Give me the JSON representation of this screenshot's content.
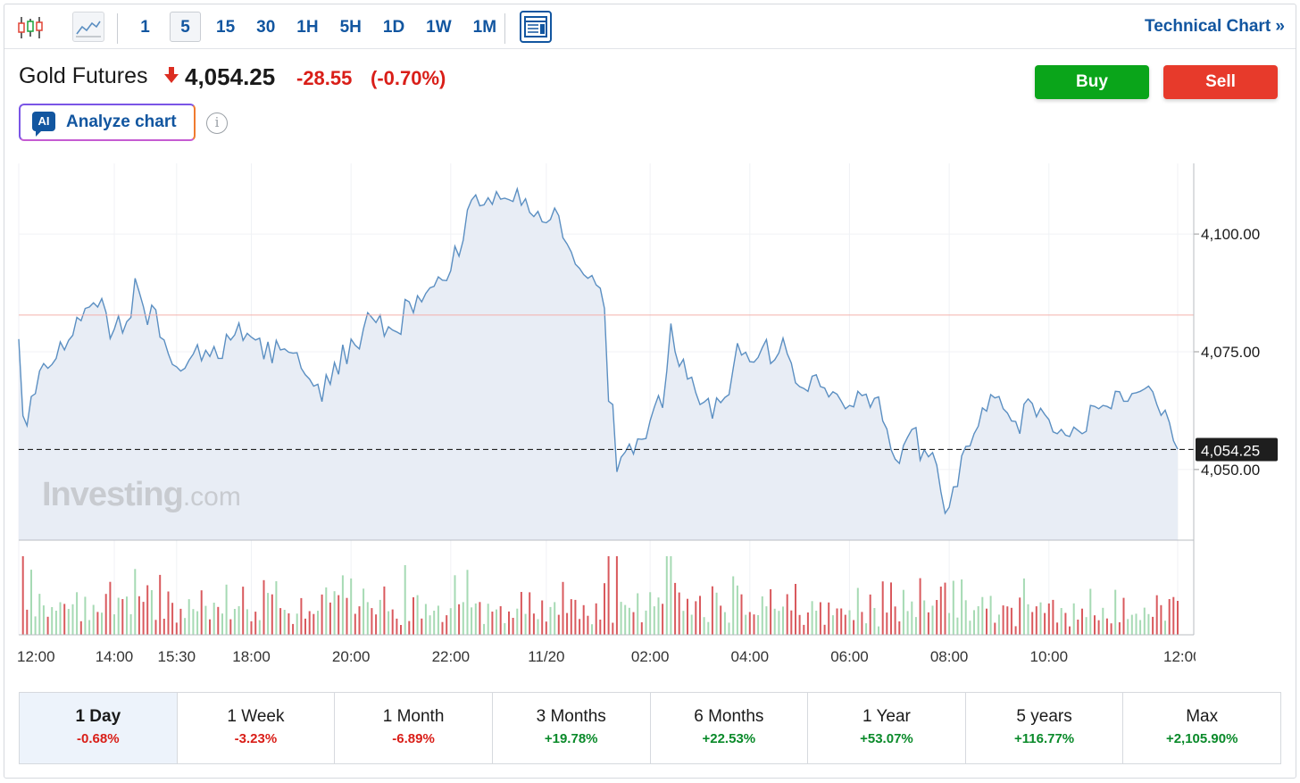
{
  "toolbar": {
    "intervals": [
      "1",
      "5",
      "15",
      "30",
      "1H",
      "5H",
      "1D",
      "1W",
      "1M"
    ],
    "active_interval": "5",
    "technical_chart_label": "Technical Chart »",
    "candle_icon": "candlestick-icon",
    "line_icon": "line-chart-icon",
    "layout_icon": "layout-icon"
  },
  "header": {
    "instrument": "Gold Futures",
    "direction_icon": "down-arrow-icon",
    "price": "4,054.25",
    "change": "-28.55",
    "change_pct": "(-0.70%)",
    "buy_label": "Buy",
    "sell_label": "Sell",
    "analyze_badge": "AI",
    "analyze_label": "Analyze chart",
    "info_icon": "i"
  },
  "watermark": {
    "brand": "Investing",
    "suffix": ".com"
  },
  "colors": {
    "line": "#5b8fc2",
    "area": "#e8edf5",
    "up_volume": "#a6dab4",
    "down_volume": "#d9595d",
    "reference_line": "#f4b0ab",
    "buy": "#0aa51a",
    "sell": "#e73a2b",
    "accent": "#1256a0"
  },
  "chart_data": {
    "type": "area",
    "ylim": [
      4035,
      4115
    ],
    "y_ticks": [
      "4,100.00",
      "4,075.00",
      "4,050.00"
    ],
    "y_tick_values": [
      4100,
      4075,
      4050
    ],
    "reference_price": 4082.8,
    "last_price": 4054.25,
    "last_price_label": "4,054.25",
    "x_labels": [
      "12:00",
      "14:00",
      "15:30",
      "18:00",
      "20:00",
      "22:00",
      "11/20",
      "02:00",
      "04:00",
      "06:00",
      "08:00",
      "10:00",
      "12:00"
    ],
    "x_label_values": [
      0,
      23,
      38,
      56,
      80,
      104,
      127,
      152,
      176,
      200,
      224,
      248,
      279
    ],
    "x_range": [
      0,
      279
    ],
    "line": [
      [
        0,
        4077.7
      ],
      [
        1,
        4061.4
      ],
      [
        2,
        4059.3
      ],
      [
        3,
        4065.5
      ],
      [
        4,
        4066.1
      ],
      [
        5,
        4070.9
      ],
      [
        6,
        4072.5
      ],
      [
        7,
        4071.5
      ],
      [
        8,
        4072.3
      ],
      [
        9,
        4073.6
      ],
      [
        10,
        4077.1
      ],
      [
        11,
        4075.4
      ],
      [
        12,
        4077.4
      ],
      [
        13,
        4078.5
      ],
      [
        14,
        4082.3
      ],
      [
        15,
        4081.6
      ],
      [
        16,
        4084.2
      ],
      [
        17,
        4084.5
      ],
      [
        18,
        4085.4
      ],
      [
        19,
        4084.5
      ],
      [
        20,
        4086.3
      ],
      [
        21,
        4083.4
      ],
      [
        22,
        4077.8
      ],
      [
        23,
        4079.8
      ],
      [
        24,
        4082.6
      ],
      [
        25,
        4079.0
      ],
      [
        26,
        4081.4
      ],
      [
        27,
        4082.3
      ],
      [
        28,
        4090.6
      ],
      [
        29,
        4087.7
      ],
      [
        30,
        4084.6
      ],
      [
        31,
        4080.7
      ],
      [
        32,
        4084.9
      ],
      [
        33,
        4083.9
      ],
      [
        34,
        4078.1
      ],
      [
        35,
        4077.5
      ],
      [
        36,
        4074.6
      ],
      [
        37,
        4072.3
      ],
      [
        38,
        4071.8
      ],
      [
        39,
        4070.9
      ],
      [
        40,
        4071.5
      ],
      [
        41,
        4073.2
      ],
      [
        42,
        4074.5
      ],
      [
        43,
        4076.5
      ],
      [
        44,
        4073.1
      ],
      [
        45,
        4075.3
      ],
      [
        46,
        4074.0
      ],
      [
        47,
        4076.1
      ],
      [
        48,
        4073.6
      ],
      [
        49,
        4073.6
      ],
      [
        50,
        4078.7
      ],
      [
        51,
        4077.5
      ],
      [
        52,
        4078.6
      ],
      [
        53,
        4081.1
      ],
      [
        54,
        4077.4
      ],
      [
        55,
        4078.9
      ],
      [
        56,
        4078.1
      ],
      [
        57,
        4077.5
      ],
      [
        58,
        4077.9
      ],
      [
        59,
        4073.4
      ],
      [
        60,
        4077.1
      ],
      [
        61,
        4072.6
      ],
      [
        62,
        4077.4
      ],
      [
        63,
        4075.4
      ],
      [
        64,
        4075.6
      ],
      [
        65,
        4074.9
      ],
      [
        66,
        4074.7
      ],
      [
        67,
        4074.8
      ],
      [
        68,
        4071.5
      ],
      [
        69,
        4070.1
      ],
      [
        70,
        4069.2
      ],
      [
        71,
        4067.7
      ],
      [
        72,
        4068.1
      ],
      [
        73,
        4064.4
      ],
      [
        74,
        4070.1
      ],
      [
        75,
        4068.1
      ],
      [
        76,
        4072.7
      ],
      [
        77,
        4070.2
      ],
      [
        78,
        4076.5
      ],
      [
        79,
        4072.4
      ],
      [
        80,
        4077.7
      ],
      [
        81,
        4076.4
      ],
      [
        82,
        4075.6
      ],
      [
        83,
        4079.9
      ],
      [
        84,
        4083.3
      ],
      [
        85,
        4082.3
      ],
      [
        86,
        4081.2
      ],
      [
        87,
        4082.8
      ],
      [
        88,
        4078.3
      ],
      [
        89,
        4080.3
      ],
      [
        90,
        4079.6
      ],
      [
        91,
        4079.2
      ],
      [
        92,
        4078.7
      ],
      [
        93,
        4086.1
      ],
      [
        94,
        4085.6
      ],
      [
        95,
        4083.3
      ],
      [
        96,
        4086.9
      ],
      [
        97,
        4085.6
      ],
      [
        98,
        4087.4
      ],
      [
        99,
        4088.6
      ],
      [
        100,
        4088.9
      ],
      [
        101,
        4090.9
      ],
      [
        102,
        4090.2
      ],
      [
        103,
        4090.1
      ],
      [
        104,
        4092.2
      ],
      [
        105,
        4097.4
      ],
      [
        106,
        4095.3
      ],
      [
        107,
        4098.7
      ],
      [
        108,
        4105.1
      ],
      [
        109,
        4107.2
      ],
      [
        110,
        4108.3
      ],
      [
        111,
        4106.0
      ],
      [
        112,
        4106.2
      ],
      [
        113,
        4107.7
      ],
      [
        114,
        4106.3
      ],
      [
        115,
        4109.0
      ],
      [
        116,
        4107.4
      ],
      [
        117,
        4107.6
      ],
      [
        118,
        4107.3
      ],
      [
        119,
        4106.9
      ],
      [
        120,
        4109.6
      ],
      [
        121,
        4106.1
      ],
      [
        122,
        4107.5
      ],
      [
        123,
        4104.6
      ],
      [
        124,
        4103.7
      ],
      [
        125,
        4104.8
      ],
      [
        126,
        4102.6
      ],
      [
        127,
        4102.4
      ],
      [
        128,
        4103.1
      ],
      [
        129,
        4105.5
      ],
      [
        130,
        4103.9
      ],
      [
        131,
        4099.2
      ],
      [
        132,
        4097.9
      ],
      [
        133,
        4096.2
      ],
      [
        134,
        4093.6
      ],
      [
        135,
        4092.7
      ],
      [
        136,
        4091.4
      ],
      [
        137,
        4090.6
      ],
      [
        138,
        4091.2
      ],
      [
        139,
        4089.2
      ],
      [
        140,
        4088.5
      ],
      [
        141,
        4084.2
      ],
      [
        142,
        4064.5
      ],
      [
        143,
        4063.8
      ],
      [
        144,
        4049.5
      ],
      [
        145,
        4052.6
      ],
      [
        146,
        4053.7
      ],
      [
        147,
        4055.4
      ],
      [
        148,
        4053.3
      ],
      [
        149,
        4056.5
      ],
      [
        150,
        4056.4
      ],
      [
        151,
        4056.6
      ],
      [
        152,
        4060.4
      ],
      [
        153,
        4063.2
      ],
      [
        154,
        4065.7
      ],
      [
        155,
        4063.1
      ],
      [
        156,
        4070.9
      ],
      [
        157,
        4081.0
      ],
      [
        158,
        4075.0
      ],
      [
        159,
        4071.9
      ],
      [
        160,
        4073.4
      ],
      [
        161,
        4069.2
      ],
      [
        162,
        4069.6
      ],
      [
        163,
        4066.3
      ],
      [
        164,
        4063.8
      ],
      [
        165,
        4064.3
      ],
      [
        166,
        4065.1
      ],
      [
        167,
        4060.8
      ],
      [
        168,
        4065.2
      ],
      [
        169,
        4064.2
      ],
      [
        170,
        4065.3
      ],
      [
        171,
        4065.9
      ],
      [
        172,
        4071.5
      ],
      [
        173,
        4076.8
      ],
      [
        174,
        4074.3
      ],
      [
        175,
        4074.9
      ],
      [
        176,
        4072.9
      ],
      [
        177,
        4072.8
      ],
      [
        178,
        4073.8
      ],
      [
        179,
        4075.9
      ],
      [
        180,
        4077.6
      ],
      [
        181,
        4072.5
      ],
      [
        182,
        4073.3
      ],
      [
        183,
        4074.8
      ],
      [
        184,
        4077.9
      ],
      [
        185,
        4074.6
      ],
      [
        186,
        4072.6
      ],
      [
        187,
        4068.4
      ],
      [
        188,
        4067.6
      ],
      [
        189,
        4067.2
      ],
      [
        190,
        4066.6
      ],
      [
        191,
        4069.8
      ],
      [
        192,
        4070.1
      ],
      [
        193,
        4067.6
      ],
      [
        194,
        4067.3
      ],
      [
        195,
        4065.4
      ],
      [
        196,
        4066.5
      ],
      [
        197,
        4066.0
      ],
      [
        198,
        4064.5
      ],
      [
        199,
        4062.9
      ],
      [
        200,
        4063.6
      ],
      [
        201,
        4063.3
      ],
      [
        202,
        4066.6
      ],
      [
        203,
        4065.7
      ],
      [
        204,
        4066.0
      ],
      [
        205,
        4063.2
      ],
      [
        206,
        4065.1
      ],
      [
        207,
        4065.4
      ],
      [
        208,
        4060.3
      ],
      [
        209,
        4058.6
      ],
      [
        210,
        4054.2
      ],
      [
        211,
        4052.2
      ],
      [
        212,
        4051.3
      ],
      [
        213,
        4055.1
      ],
      [
        214,
        4056.9
      ],
      [
        215,
        4058.5
      ],
      [
        216,
        4058.9
      ],
      [
        217,
        4052.0
      ],
      [
        218,
        4054.2
      ],
      [
        219,
        4052.7
      ],
      [
        220,
        4053.6
      ],
      [
        221,
        4050.9
      ],
      [
        222,
        4045.3
      ],
      [
        223,
        4040.7
      ],
      [
        224,
        4042.0
      ],
      [
        225,
        4046.3
      ],
      [
        226,
        4046.4
      ],
      [
        227,
        4052.9
      ],
      [
        228,
        4054.9
      ],
      [
        229,
        4055.0
      ],
      [
        230,
        4057.6
      ],
      [
        231,
        4059.2
      ],
      [
        232,
        4063.1
      ],
      [
        233,
        4062.4
      ],
      [
        234,
        4065.9
      ],
      [
        235,
        4065.2
      ],
      [
        236,
        4065.5
      ],
      [
        237,
        4062.9
      ],
      [
        238,
        4062.0
      ],
      [
        239,
        4060.3
      ],
      [
        240,
        4060.2
      ],
      [
        241,
        4057.6
      ],
      [
        242,
        4063.9
      ],
      [
        243,
        4065.0
      ],
      [
        244,
        4064.0
      ],
      [
        245,
        4061.2
      ],
      [
        246,
        4063.0
      ],
      [
        247,
        4061.7
      ],
      [
        248,
        4060.6
      ],
      [
        249,
        4058.0
      ],
      [
        250,
        4057.6
      ],
      [
        251,
        4058.5
      ],
      [
        252,
        4057.3
      ],
      [
        253,
        4057.0
      ],
      [
        254,
        4059.0
      ],
      [
        255,
        4058.3
      ],
      [
        256,
        4057.6
      ],
      [
        257,
        4058.1
      ],
      [
        258,
        4063.6
      ],
      [
        259,
        4063.4
      ],
      [
        260,
        4062.9
      ],
      [
        261,
        4063.6
      ],
      [
        262,
        4063.4
      ],
      [
        263,
        4062.9
      ],
      [
        264,
        4066.6
      ],
      [
        265,
        4066.5
      ],
      [
        266,
        4064.5
      ],
      [
        267,
        4064.5
      ],
      [
        268,
        4066.1
      ],
      [
        269,
        4066.3
      ],
      [
        270,
        4066.6
      ],
      [
        271,
        4067.1
      ],
      [
        272,
        4067.7
      ],
      [
        273,
        4066.5
      ],
      [
        274,
        4063.8
      ],
      [
        275,
        4061.5
      ],
      [
        276,
        4062.6
      ],
      [
        277,
        4060.0
      ],
      [
        278,
        4056.1
      ],
      [
        279,
        4054.3
      ]
    ],
    "volume_scale_max": 100
  },
  "periods": [
    {
      "label": "1 Day",
      "value": "-0.68%",
      "sign": "neg"
    },
    {
      "label": "1 Week",
      "value": "-3.23%",
      "sign": "neg"
    },
    {
      "label": "1 Month",
      "value": "-6.89%",
      "sign": "neg"
    },
    {
      "label": "3 Months",
      "value": "+19.78%",
      "sign": "pos"
    },
    {
      "label": "6 Months",
      "value": "+22.53%",
      "sign": "pos"
    },
    {
      "label": "1 Year",
      "value": "+53.07%",
      "sign": "pos"
    },
    {
      "label": "5 years",
      "value": "+116.77%",
      "sign": "pos"
    },
    {
      "label": "Max",
      "value": "+2,105.90%",
      "sign": "pos"
    }
  ],
  "active_period": "1 Day"
}
